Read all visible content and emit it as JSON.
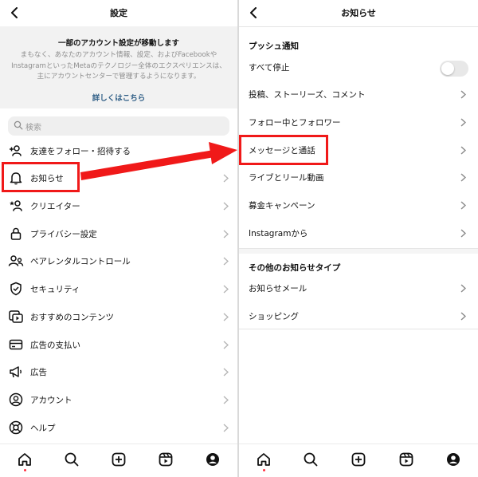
{
  "left": {
    "title": "設定",
    "notice": {
      "title": "一部のアカウント設定が移動します",
      "body": "まもなく、あなたのアカウント情報、設定、およびFacebookやInstagramといったMetaのテクノロジー全体のエクスペリエンスは、主にアカウントセンターで管理するようになります。",
      "link": "詳しくはこちら"
    },
    "search_placeholder": "検索",
    "items": [
      {
        "label": "友達をフォロー・招待する",
        "icon": "add-person-icon"
      },
      {
        "label": "お知らせ",
        "icon": "bell-icon"
      },
      {
        "label": "クリエイター",
        "icon": "creator-icon"
      },
      {
        "label": "プライバシー設定",
        "icon": "lock-icon"
      },
      {
        "label": "ペアレンタルコントロール",
        "icon": "family-icon"
      },
      {
        "label": "セキュリティ",
        "icon": "shield-icon"
      },
      {
        "label": "おすすめのコンテンツ",
        "icon": "content-icon"
      },
      {
        "label": "広告の支払い",
        "icon": "card-icon"
      },
      {
        "label": "広告",
        "icon": "megaphone-icon"
      },
      {
        "label": "アカウント",
        "icon": "account-icon"
      },
      {
        "label": "ヘルプ",
        "icon": "help-icon"
      }
    ]
  },
  "right": {
    "title": "お知らせ",
    "push_section": "プッシュ通知",
    "pause_all": "すべて停止",
    "pause_all_on": false,
    "push_items": [
      {
        "label": "投稿、ストーリーズ、コメント"
      },
      {
        "label": "フォロー中とフォロワー"
      },
      {
        "label": "メッセージと通話"
      },
      {
        "label": "ライブとリール動画"
      },
      {
        "label": "募金キャンペーン"
      },
      {
        "label": "Instagramから"
      }
    ],
    "other_section": "その他のお知らせタイプ",
    "other_items": [
      {
        "label": "お知らせメール"
      },
      {
        "label": "ショッピング"
      }
    ]
  },
  "tabs": [
    "home-icon",
    "search-icon",
    "create-icon",
    "reels-icon",
    "profile-icon"
  ],
  "colors": {
    "highlight": "#f01919",
    "link": "#2f5e86",
    "notification_dot": "#ff3040"
  }
}
